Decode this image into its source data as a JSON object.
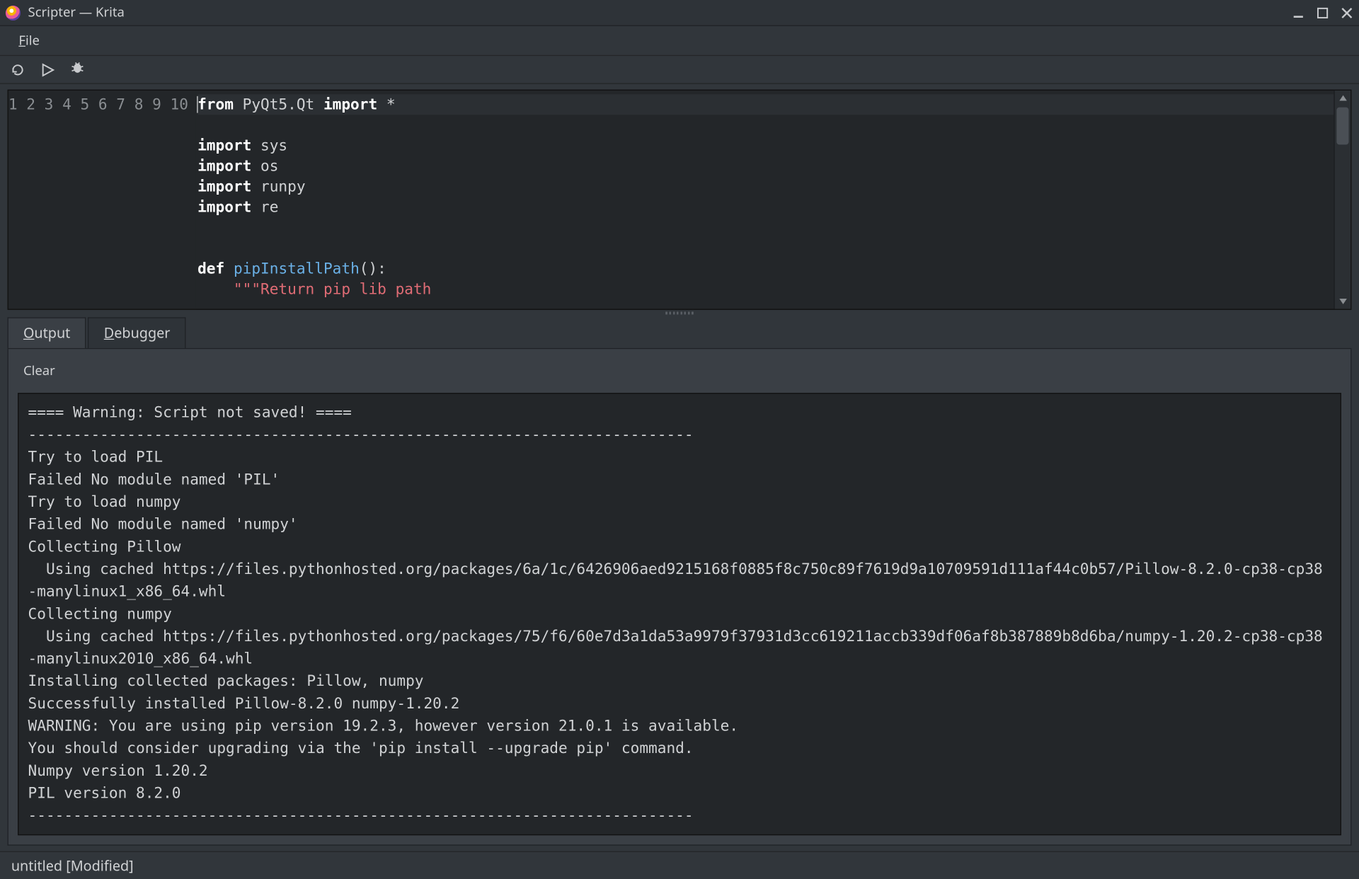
{
  "window": {
    "title": "Scripter — Krita"
  },
  "menu": {
    "file": "File"
  },
  "tabs": {
    "output": "Output",
    "debugger": "Debugger"
  },
  "output_toolbar": {
    "clear": "Clear"
  },
  "editor": {
    "line_numbers": [
      "1",
      "2",
      "3",
      "4",
      "5",
      "6",
      "7",
      "8",
      "9",
      "10"
    ],
    "lines": [
      {
        "raw": "from PyQt5.Qt import *"
      },
      {
        "raw": ""
      },
      {
        "raw": "import sys"
      },
      {
        "raw": "import os"
      },
      {
        "raw": "import runpy"
      },
      {
        "raw": "import re"
      },
      {
        "raw": ""
      },
      {
        "raw": ""
      },
      {
        "raw": "def pipInstallPath():"
      },
      {
        "raw": "    \"\"\"Return pip lib path"
      }
    ]
  },
  "output": {
    "text": "==== Warning: Script not saved! ====\n--------------------------------------------------------------------------\nTry to load PIL\nFailed No module named 'PIL'\nTry to load numpy\nFailed No module named 'numpy'\nCollecting Pillow\n  Using cached https://files.pythonhosted.org/packages/6a/1c/6426906aed9215168f0885f8c750c89f7619d9a10709591d111af44c0b57/Pillow-8.2.0-cp38-cp38-manylinux1_x86_64.whl\nCollecting numpy\n  Using cached https://files.pythonhosted.org/packages/75/f6/60e7d3a1da53a9979f37931d3cc619211accb339df06af8b387889b8d6ba/numpy-1.20.2-cp38-cp38-manylinux2010_x86_64.whl\nInstalling collected packages: Pillow, numpy\nSuccessfully installed Pillow-8.2.0 numpy-1.20.2\nWARNING: You are using pip version 19.2.3, however version 21.0.1 is available.\nYou should consider upgrading via the 'pip install --upgrade pip' command.\nNumpy version 1.20.2\nPIL version 8.2.0\n--------------------------------------------------------------------------\n"
  },
  "status": {
    "text": "untitled [Modified]"
  }
}
